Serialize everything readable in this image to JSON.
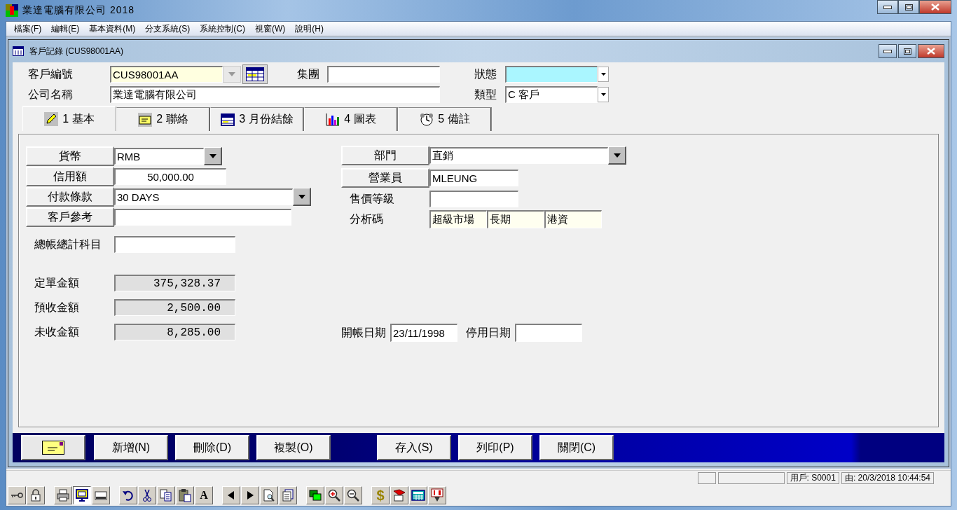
{
  "window": {
    "title": "業達電腦有限公司 2018"
  },
  "menu": [
    "檔案(F)",
    "編輯(E)",
    "基本資料(M)",
    "分支系統(S)",
    "系統控制(C)",
    "視窗(W)",
    "說明(H)"
  ],
  "child_window": {
    "title": "客戶記錄 (CUS98001AA)"
  },
  "header": {
    "customer_no": {
      "label": "客戶編號",
      "value": "CUS98001AA"
    },
    "group": {
      "label": "集團"
    },
    "status": {
      "label": "狀態"
    },
    "company_name": {
      "label": "公司名稱",
      "value": "業達電腦有限公司"
    },
    "type": {
      "label": "類型",
      "value": "C 客戶"
    }
  },
  "tabs": [
    {
      "label": "1 基本",
      "selected": true
    },
    {
      "label": "2 聯絡",
      "selected": false
    },
    {
      "label": "3 月份結餘",
      "selected": false
    },
    {
      "label": "4 圖表",
      "selected": false
    },
    {
      "label": "5 備註",
      "selected": false
    }
  ],
  "left_fields": [
    {
      "label": "貨幣",
      "label_button": true,
      "kind": "dropdown",
      "value": "RMB"
    },
    {
      "label": "信用額",
      "label_button": true,
      "kind": "amount",
      "value": "50,000.00"
    },
    {
      "label": "付款條款",
      "label_button": true,
      "kind": "long-dropdown",
      "value": "30 DAYS"
    },
    {
      "label": "客戶參考",
      "label_button": true,
      "kind": "long-text"
    },
    {
      "label": "總帳總計科目",
      "label_button": false,
      "kind": "text"
    }
  ],
  "totals": [
    {
      "label": "定單金額",
      "value": "375,328.37"
    },
    {
      "label": "預收金額",
      "value": "2,500.00"
    },
    {
      "label": "未收金額",
      "value": "8,285.00"
    }
  ],
  "right_fields": [
    {
      "label": "部門",
      "label_button": true,
      "kind": "long-dropdown",
      "value": "直銷"
    },
    {
      "label": "營業員",
      "label_button": true,
      "kind": "text",
      "value": "MLEUNG"
    },
    {
      "label": "售價等級",
      "label_button": false,
      "kind": "text"
    },
    {
      "label": "分析碼",
      "label_button": false,
      "kind": "codes",
      "values": [
        "超級市場",
        "長期",
        "港資"
      ]
    }
  ],
  "dates": [
    {
      "label": "開帳日期",
      "value": "23/11/1998"
    },
    {
      "label": "停用日期"
    }
  ],
  "buttons_left": [
    "新增(N)",
    "刪除(D)",
    "複製(O)"
  ],
  "buttons_right": [
    "存入(S)",
    "列印(P)",
    "關閉(C)"
  ],
  "status_bar": [
    "用戶: S0001",
    "由: 20/3/2018 10:44:54"
  ],
  "toolbar": {
    "font_glyph": "A",
    "currency_glyph": "$"
  }
}
